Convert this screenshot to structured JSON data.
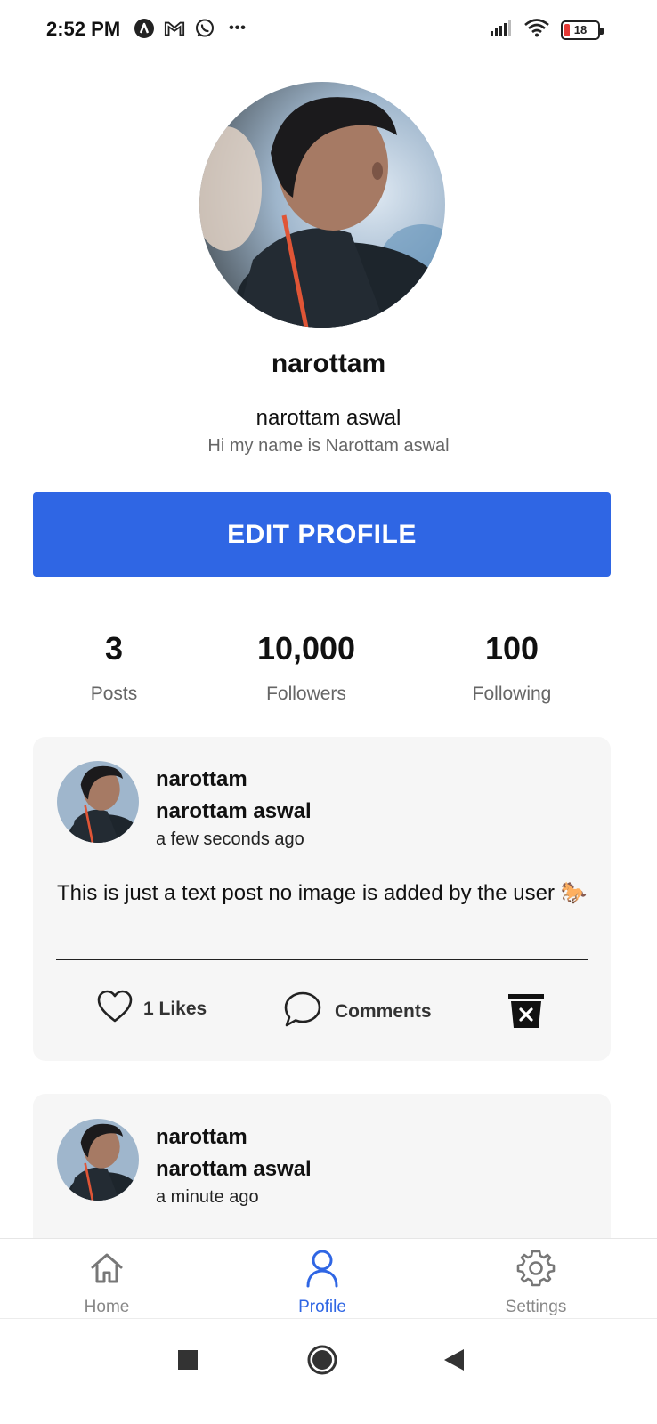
{
  "status_bar": {
    "time": "2:52 PM",
    "battery_level": "18",
    "battery_fraction": 0.18,
    "more_glyph": "•••",
    "icons": [
      "app-a-icon",
      "gmail-icon",
      "whatsapp-icon",
      "more-icon",
      "signal-icon",
      "wifi-icon",
      "battery-icon"
    ]
  },
  "profile": {
    "username": "narottam",
    "full_name": "narottam aswal",
    "bio": "Hi my name is Narottam aswal",
    "edit_button_label": "EDIT PROFILE"
  },
  "stats": [
    {
      "value": "3",
      "label": "Posts"
    },
    {
      "value": "10,000",
      "label": "Followers"
    },
    {
      "value": "100",
      "label": "Following"
    }
  ],
  "posts": [
    {
      "username": "narottam",
      "full_name": "narottam aswal",
      "time": "a few seconds ago",
      "text": "This is just a text post no image is added by the user 🐎",
      "likes_label": "1 Likes",
      "comments_label": "Comments"
    },
    {
      "username": "narottam",
      "full_name": "narottam aswal",
      "time": "a minute ago"
    }
  ],
  "bottom_nav": {
    "items": [
      {
        "label": "Home",
        "icon": "home-icon"
      },
      {
        "label": "Profile",
        "icon": "person-icon",
        "active": true
      },
      {
        "label": "Settings",
        "icon": "gear-icon"
      }
    ]
  },
  "colors": {
    "accent": "#2f66e4",
    "card_bg": "#f6f6f6",
    "muted_text": "#666666"
  }
}
